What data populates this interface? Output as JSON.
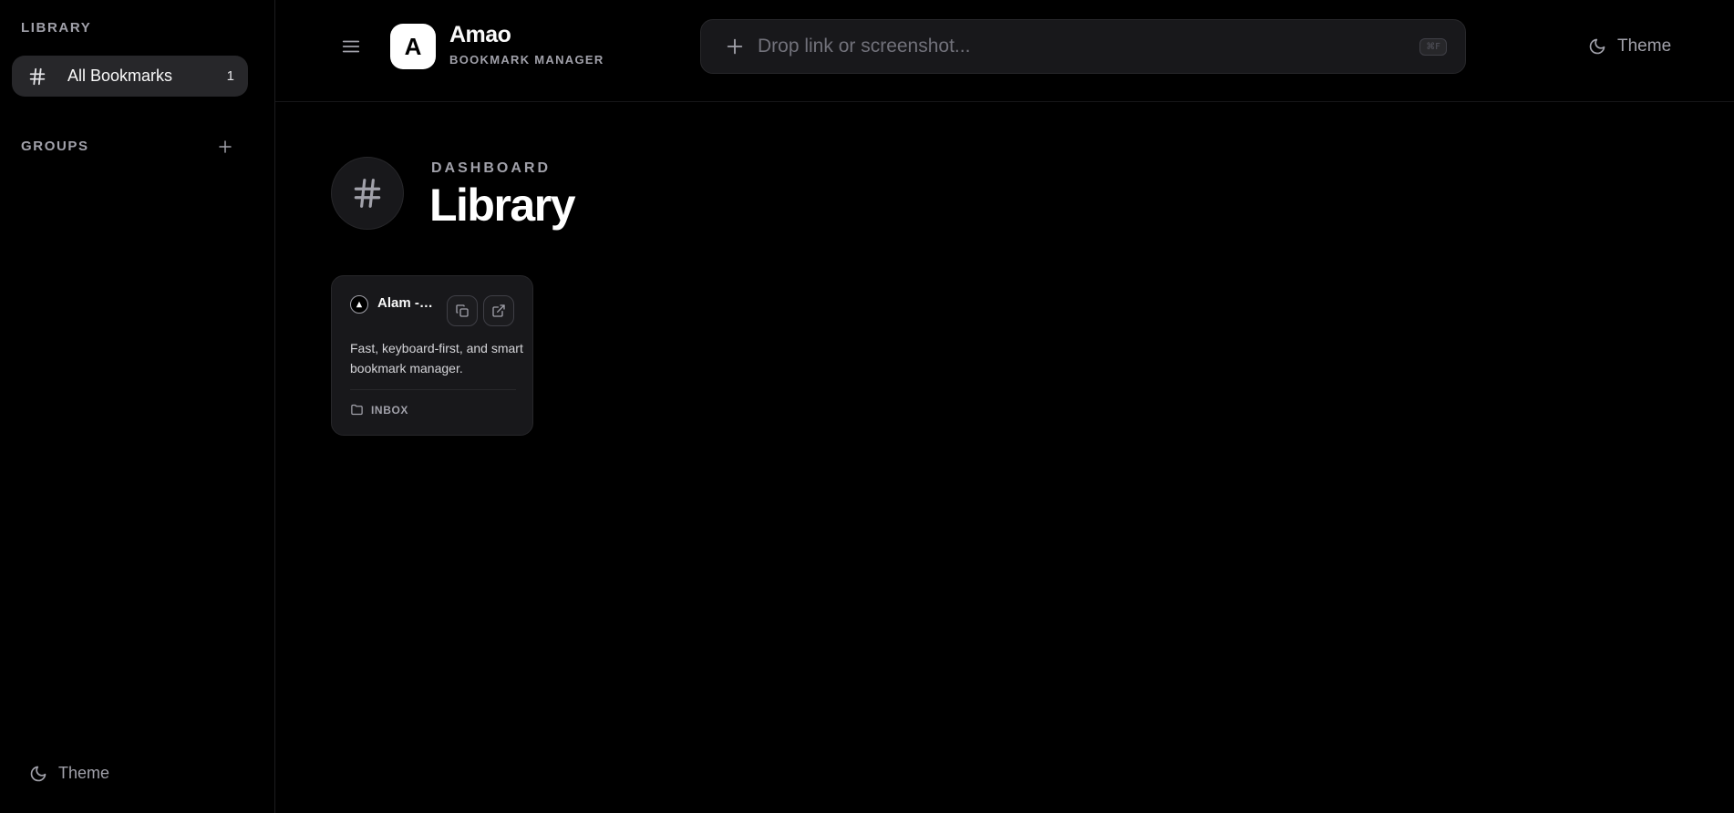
{
  "sidebar": {
    "library_title": "LIBRARY",
    "items": [
      {
        "icon": "hash-icon",
        "label": "All Bookmarks",
        "count": "1"
      }
    ],
    "groups_title": "GROUPS",
    "theme_label": "Theme"
  },
  "header": {
    "logo_letter": "A",
    "app_name": "Amao",
    "app_subtitle": "BOOKMARK MANAGER",
    "search_placeholder": "Drop link or screenshot...",
    "search_value": "",
    "shortcut": "⌘F",
    "theme_label": "Theme"
  },
  "main": {
    "eyebrow": "DASHBOARD",
    "title": "Library",
    "bookmarks": [
      {
        "title": "Alam - Fast, keyboard-first, and smart bookmark manager",
        "description": "Fast, keyboard-first, and smart bookmark manager.",
        "folder": "INBOX"
      }
    ]
  },
  "colors": {
    "background": "#000000",
    "surface": "#18181b",
    "border": "#27272a",
    "muted_text": "#a1a1aa"
  }
}
